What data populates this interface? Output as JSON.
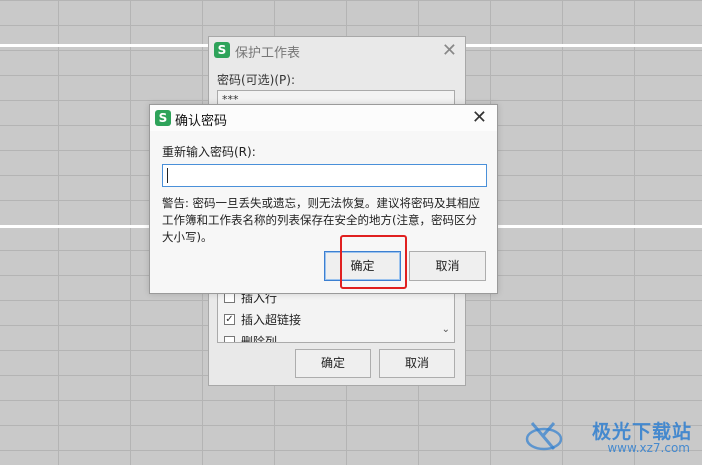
{
  "background_dialog": {
    "logo": "S",
    "title": "保护工作表",
    "close": "✕",
    "password_label": "密码(可选)(P):",
    "password_value": "***",
    "permissions": [
      {
        "label": "插入行",
        "checked": false
      },
      {
        "label": "插入超链接",
        "checked": true
      },
      {
        "label": "删除列",
        "checked": false
      }
    ],
    "ok_label": "确定",
    "cancel_label": "取消"
  },
  "dialog": {
    "logo": "S",
    "title": "确认密码",
    "close": "✕",
    "prompt_label": "重新输入密码(R):",
    "input_value": "",
    "warning": "警告: 密码一旦丢失或遗忘，则无法恢复。建议将密码及其相应工作簿和工作表名称的列表保存在安全的地方(注意，密码区分大小写)。",
    "ok_label": "确定",
    "cancel_label": "取消"
  },
  "watermark": {
    "title": "极光下载站",
    "url": "www.xz7.com"
  },
  "colors": {
    "logo_green": "#2ea35a",
    "highlight_red": "#e02020",
    "focus_blue": "#3c7fd1"
  }
}
